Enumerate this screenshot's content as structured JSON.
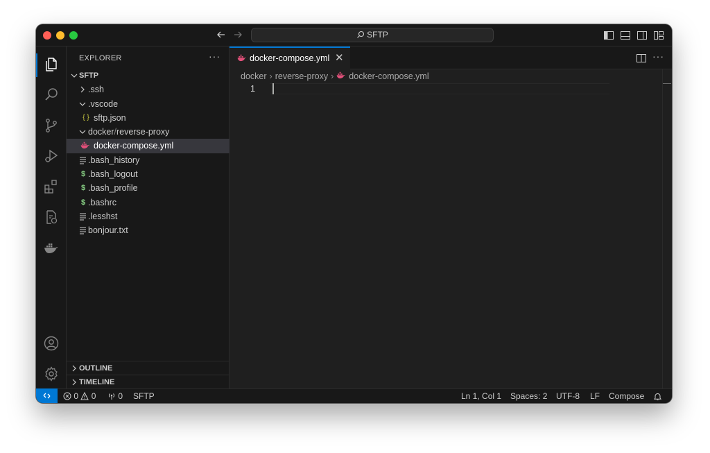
{
  "titlebar": {
    "search_text": "SFTP",
    "traffic_lights": [
      "close",
      "minimize",
      "maximize"
    ],
    "icons": [
      "arrow-left-icon",
      "arrow-right-icon",
      "toggle-primary-sidebar-icon",
      "toggle-panel-icon",
      "toggle-secondary-sidebar-icon",
      "customize-layout-icon"
    ]
  },
  "activity_bar": {
    "items": [
      "explorer-icon",
      "search-icon",
      "source-control-icon",
      "run-debug-icon",
      "extensions-icon",
      "remote-explorer-icon",
      "docker-icon"
    ],
    "bottom_items": [
      "account-icon",
      "settings-gear-icon"
    ],
    "active": "explorer-icon"
  },
  "sidebar": {
    "title": "EXPLORER",
    "more": "···",
    "root": "SFTP",
    "tree": [
      {
        "label": ".ssh",
        "type": "folder",
        "expanded": false
      },
      {
        "label": ".vscode",
        "type": "folder",
        "expanded": true
      },
      {
        "label": "sftp.json",
        "type": "json",
        "icon_text": "{ }"
      },
      {
        "label_a": "docker",
        "label_sep": "/",
        "label_b": "reverse-proxy",
        "type": "folder",
        "expanded": true
      },
      {
        "label": "docker-compose.yml",
        "type": "docker",
        "selected": true
      },
      {
        "label": ".bash_history",
        "type": "text"
      },
      {
        "label": ".bash_logout",
        "type": "shell",
        "icon_text": "$"
      },
      {
        "label": ".bash_profile",
        "type": "shell",
        "icon_text": "$"
      },
      {
        "label": ".bashrc",
        "type": "shell",
        "icon_text": "$"
      },
      {
        "label": ".lesshst",
        "type": "text"
      },
      {
        "label": "bonjour.txt",
        "type": "text"
      }
    ],
    "sections": [
      "OUTLINE",
      "TIMELINE"
    ]
  },
  "editor": {
    "tab": {
      "label": "docker-compose.yml",
      "close": "✕"
    },
    "breadcrumb": [
      "docker",
      "reverse-proxy",
      "docker-compose.yml"
    ],
    "line_number": "1",
    "content": ""
  },
  "statusbar": {
    "errors": "0",
    "warnings": "0",
    "ports": "0",
    "remote_name": "SFTP",
    "position": "Ln 1, Col 1",
    "indent": "Spaces: 2",
    "encoding": "UTF-8",
    "eol": "LF",
    "language": "Compose"
  },
  "colors": {
    "accent": "#0078d4",
    "docker_pink": "#e2507a",
    "json_yellow": "#cbcb41",
    "shell_green": "#89d185"
  }
}
